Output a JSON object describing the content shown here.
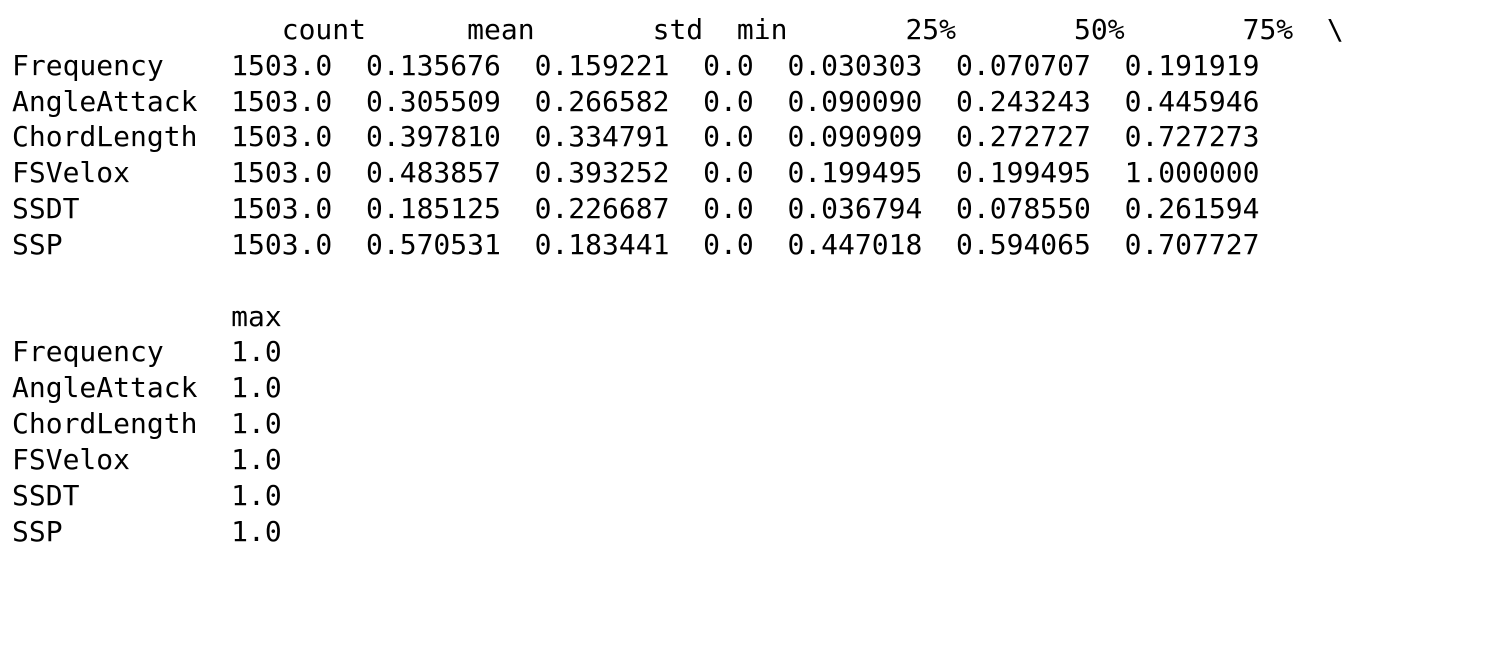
{
  "describe": {
    "row_blank": "                count      mean       std  min       25%       50%       75%  \\",
    "rows": [
      "Frequency    1503.0  0.135676  0.159221  0.0  0.030303  0.070707  0.191919",
      "AngleAttack  1503.0  0.305509  0.266582  0.0  0.090090  0.243243  0.445946",
      "ChordLength  1503.0  0.397810  0.334791  0.0  0.090909  0.272727  0.727273",
      "FSVelox      1503.0  0.483857  0.393252  0.0  0.199495  0.199495  1.000000",
      "SSDT         1503.0  0.185125  0.226687  0.0  0.036794  0.078550  0.261594",
      "SSP          1503.0  0.570531  0.183441  0.0  0.447018  0.594065  0.707727"
    ],
    "row_blank_2": "             max",
    "rows2": [
      "Frequency    1.0",
      "AngleAttack  1.0",
      "ChordLength  1.0",
      "FSVelox      1.0",
      "SSDT         1.0",
      "SSP          1.0"
    ]
  },
  "chart_data": {
    "type": "table",
    "index": [
      "Frequency",
      "AngleAttack",
      "ChordLength",
      "FSVelox",
      "SSDT",
      "SSP"
    ],
    "columns": [
      "count",
      "mean",
      "std",
      "min",
      "25%",
      "50%",
      "75%",
      "max"
    ],
    "data": {
      "Frequency": {
        "count": 1503.0,
        "mean": 0.135676,
        "std": 0.159221,
        "min": 0.0,
        "25%": 0.030303,
        "50%": 0.070707,
        "75%": 0.191919,
        "max": 1.0
      },
      "AngleAttack": {
        "count": 1503.0,
        "mean": 0.305509,
        "std": 0.266582,
        "min": 0.0,
        "25%": 0.09009,
        "50%": 0.243243,
        "75%": 0.445946,
        "max": 1.0
      },
      "ChordLength": {
        "count": 1503.0,
        "mean": 0.39781,
        "std": 0.334791,
        "min": 0.0,
        "25%": 0.090909,
        "50%": 0.272727,
        "75%": 0.727273,
        "max": 1.0
      },
      "FSVelox": {
        "count": 1503.0,
        "mean": 0.483857,
        "std": 0.393252,
        "min": 0.0,
        "25%": 0.199495,
        "50%": 0.199495,
        "75%": 1.0,
        "max": 1.0
      },
      "SSDT": {
        "count": 1503.0,
        "mean": 0.185125,
        "std": 0.226687,
        "min": 0.0,
        "25%": 0.036794,
        "50%": 0.07855,
        "75%": 0.261594,
        "max": 1.0
      },
      "SSP": {
        "count": 1503.0,
        "mean": 0.570531,
        "std": 0.183441,
        "min": 0.0,
        "25%": 0.447018,
        "50%": 0.594065,
        "75%": 0.707727,
        "max": 1.0
      }
    }
  }
}
